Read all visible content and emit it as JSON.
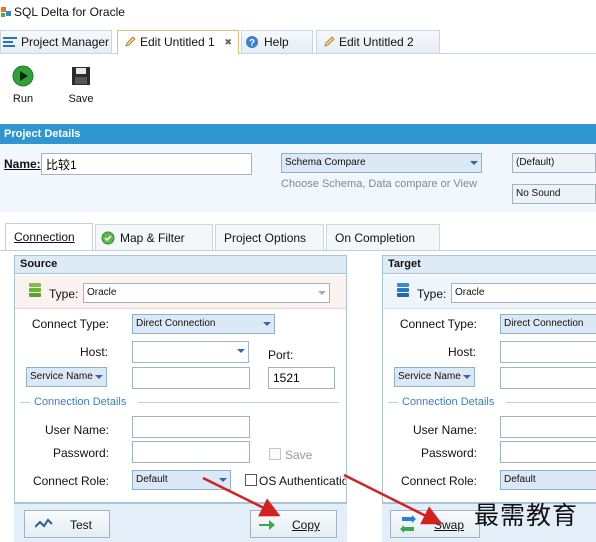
{
  "window": {
    "title": "SQL Delta for Oracle"
  },
  "doc_tabs": [
    {
      "label": "Project Manager"
    },
    {
      "label": "Edit Untitled 1",
      "close": "✖"
    },
    {
      "label": "Help"
    },
    {
      "label": "Edit Untitled 2"
    }
  ],
  "toolbar": {
    "run_label": "Run",
    "save_label": "Save"
  },
  "project_details": {
    "header": "Project Details",
    "name_label": "Name:",
    "name_value": "比较1",
    "compare_type": "Schema Compare",
    "compare_hint": "Choose Schema, Data compare or View",
    "default_option": "(Default)",
    "sound_option": "No Sound"
  },
  "config_tabs": [
    {
      "label": "Connection"
    },
    {
      "label": "Map & Filter"
    },
    {
      "label": "Project Options"
    },
    {
      "label": "On Completion"
    }
  ],
  "source": {
    "header": "Source",
    "type_label": "Type:",
    "type_value": "Oracle",
    "connect_type_label": "Connect Type:",
    "connect_type_value": "Direct Connection",
    "host_label": "Host:",
    "host_value": "",
    "port_label": "Port:",
    "port_value": "1521",
    "service_selector": "Service Name",
    "service_value": "",
    "details_label": "Connection Details",
    "username_label": "User Name:",
    "password_label": "Password:",
    "save_label": "Save",
    "role_label": "Connect Role:",
    "role_value": "Default",
    "os_auth_label": "OS Authenticatio",
    "test_button": "Test",
    "copy_button": "Copy"
  },
  "target": {
    "header": "Target",
    "type_label": "Type:",
    "type_value": "Oracle",
    "connect_type_label": "Connect Type:",
    "connect_type_value": "Direct Connection",
    "host_label": "Host:",
    "service_selector": "Service Name",
    "details_label": "Connection Details",
    "username_label": "User Name:",
    "password_label": "Password:",
    "role_label": "Connect Role:",
    "role_value": "Default",
    "swap_button": "Swap"
  },
  "watermark": "最需教育",
  "colors": {
    "accent": "#2e97d1",
    "panel_header": "#dcebf6",
    "arrow": "#d62020"
  }
}
